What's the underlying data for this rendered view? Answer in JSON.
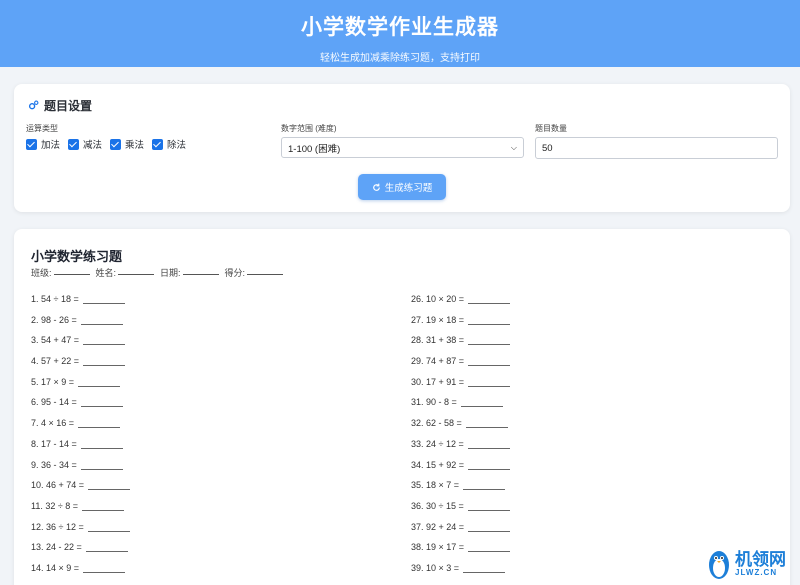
{
  "header": {
    "title": "小学数学作业生成器",
    "subtitle": "轻松生成加减乘除练习题，支持打印"
  },
  "settings": {
    "title": "题目设置",
    "operation_label": "运算类型",
    "operations": [
      "加法",
      "减法",
      "乘法",
      "除法"
    ],
    "range_label": "数字范围 (难度)",
    "range_value": "1-100 (困难)",
    "count_label": "题目数量",
    "count_value": "50",
    "generate_button": "生成练习题"
  },
  "sheet": {
    "title": "小学数学练习题",
    "info": [
      "班级:",
      "姓名:",
      "日期:",
      "得分:"
    ],
    "left_problems": [
      "1. 54 ÷ 18 =",
      "2. 98 - 26 =",
      "3. 54 + 47 =",
      "4. 57 + 22 =",
      "5. 17 × 9 =",
      "6. 95 - 14 =",
      "7. 4 × 16 =",
      "8. 17 - 14 =",
      "9. 36 - 34 =",
      "10. 46 + 74 =",
      "11. 32 ÷ 8 =",
      "12. 36 ÷ 12 =",
      "13. 24 - 22 =",
      "14. 14 × 9 ="
    ],
    "right_problems": [
      "26. 10 × 20 =",
      "27. 19 × 18 =",
      "28. 31 + 38 =",
      "29. 74 + 87 =",
      "30. 17 + 91 =",
      "31. 90 - 8 =",
      "32. 62 - 58 =",
      "33. 24 ÷ 12 =",
      "34. 15 + 92 =",
      "35. 18 × 7 =",
      "36. 30 ÷ 15 =",
      "37. 92 + 24 =",
      "38. 19 × 17 =",
      "39. 10 × 3 ="
    ]
  },
  "watermark": {
    "main": "机领网",
    "sub": "JLWZ.CN"
  },
  "colors": {
    "accent": "#5ea3f7",
    "checkbox": "#1a73e8"
  }
}
